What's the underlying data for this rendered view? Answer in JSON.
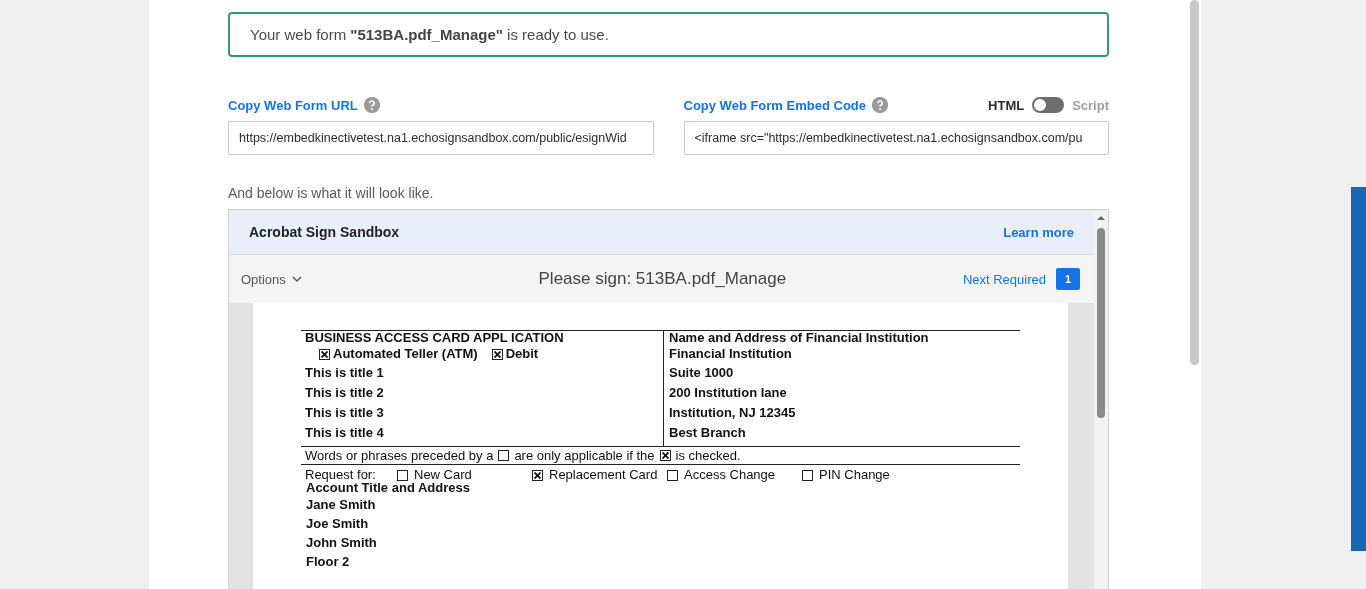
{
  "banner": {
    "text": "Your web form **\"513BA.pdf_Manage\"** is ready to use."
  },
  "url_section": {
    "label": "Copy Web Form URL",
    "value": "https://embedkinectivetest.na1.echosignsandbox.com/public/esignWid"
  },
  "embed_section": {
    "label": "Copy Web Form Embed Code",
    "value": "<iframe src=\"https://embedkinectivetest.na1.echosignsandbox.com/pu",
    "toggle": {
      "left_label": "HTML",
      "right_label": "Script",
      "on": false
    }
  },
  "preview_caption": "And below is what it will look like.",
  "preview": {
    "header": {
      "title": "Acrobat Sign Sandbox",
      "link": "Learn more"
    },
    "toolbar": {
      "options": "Options",
      "title": "Please sign: 513BA.pdf_Manage",
      "next": "Next Required",
      "count": "1"
    },
    "document": {
      "left": {
        "heading": "BUSINESS ACCESS CARD APPL ICATION",
        "checks": [
          {
            "label": "Automated Teller (ATM)",
            "checked": true
          },
          {
            "label": "Debit",
            "checked": true
          }
        ],
        "lines": [
          "This is title 1",
          "This is title 2",
          "This is title 3",
          "This is title 4"
        ]
      },
      "right": {
        "heading": "Name and Address of Financial Institution",
        "lines": [
          "Financial Institution",
          "Suite 1000",
          "200 Institution lane",
          "Institution, NJ 12345",
          "Best Branch"
        ]
      },
      "note": {
        "before": "Words or phrases preceded by a",
        "first_box_checked": false,
        "middle": "are only applicable if the",
        "second_box_checked": true,
        "after": "is checked."
      },
      "request": {
        "label": "Request for:",
        "options": [
          {
            "label": "New Card",
            "checked": false
          },
          {
            "label": "Replacement Card",
            "checked": true
          },
          {
            "label": "Access Change",
            "checked": false
          },
          {
            "label": "PIN Change",
            "checked": false
          }
        ]
      },
      "account": {
        "heading": "Account Title and Address",
        "lines": [
          "Jane Smith",
          "Joe Smith",
          "John Smith",
          "Floor 2"
        ]
      }
    }
  }
}
